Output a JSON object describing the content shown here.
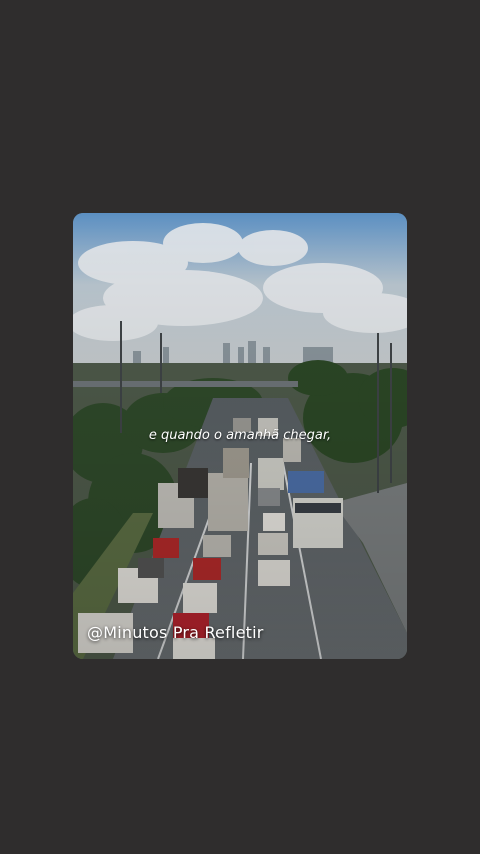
{
  "post": {
    "caption": "e quando o amanhã chegar,",
    "handle": "@Minutos Pra Refletir"
  },
  "colors": {
    "background": "#2f2d2d",
    "text": "#ffffff"
  }
}
